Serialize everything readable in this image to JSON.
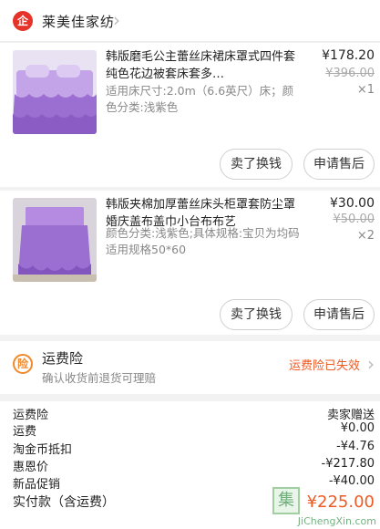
{
  "shop": {
    "name": "莱美佳家纺",
    "icon": "shop-logo-icon",
    "icon_glyph": "企"
  },
  "items": [
    {
      "title": "韩版磨毛公主蕾丝床裙床罩式四件套纯色花边被套床套多…",
      "spec": "适用床尺寸:2.0m（6.6英尺）床；颜色分类:浅紫色",
      "price": "¥178.20",
      "original_price": "¥396.00",
      "quantity": "×1",
      "buttons": {
        "sell": "卖了换钱",
        "refund": "申请售后"
      }
    },
    {
      "title": "韩版夹棉加厚蕾丝床头柜罩套防尘罩 婚庆盖布盖巾小台布布艺",
      "spec": "颜色分类:浅紫色;具体规格:宝贝为均码适用规格50*60",
      "price": "¥30.00",
      "original_price": "¥50.00",
      "quantity": "×2",
      "buttons": {
        "sell": "卖了换钱",
        "refund": "申请售后"
      }
    }
  ],
  "insurance": {
    "icon_glyph": "险",
    "title": "运费险",
    "subtitle": "确认收货前退货可理赔",
    "status": "运费险已失效"
  },
  "summary": {
    "rows": [
      {
        "label": "运费险",
        "value": "卖家赠送"
      },
      {
        "label": "运费",
        "value": "¥0.00"
      },
      {
        "label": "淘金币抵扣",
        "value": "-¥4.76"
      },
      {
        "label": "惠恩价",
        "value": "-¥217.80"
      },
      {
        "label": "新品促销",
        "value": "-¥40.00"
      }
    ],
    "total_label": "实付款（含运费）",
    "total_value": "¥225.00"
  },
  "watermark": {
    "glyph": "集",
    "text": "JiChengXin.com"
  },
  "colors": {
    "accent": "#ee5a24",
    "shop_red": "#e5332a",
    "thumb_purple": "#9b6fd1"
  }
}
